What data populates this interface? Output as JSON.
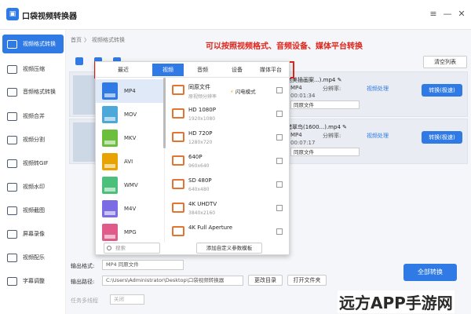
{
  "app": {
    "title": "口袋视频转换器",
    "window_controls": [
      "≡",
      "—",
      "✕"
    ]
  },
  "sidebar": {
    "items": [
      {
        "label": "视频格式转换",
        "active": true
      },
      {
        "label": "视频压缩"
      },
      {
        "label": "音频格式转换"
      },
      {
        "label": "视频合并"
      },
      {
        "label": "视频分割"
      },
      {
        "label": "视频转GIF"
      },
      {
        "label": "视频水印"
      },
      {
        "label": "视频截图"
      },
      {
        "label": "屏幕录像"
      },
      {
        "label": "视频配乐"
      },
      {
        "label": "字幕调整"
      }
    ]
  },
  "breadcrumb": [
    "首页",
    "〉",
    "视频格式转换"
  ],
  "annotation": "可以按照视频格式、音频设备、媒体平台转换",
  "toolbar": {
    "clear_label": "清空列表"
  },
  "tasks": [
    {
      "name": "绝美插画案...).mp4 ✎",
      "format": "MP4",
      "resolution_label": "分辨率:",
      "duration": "00:01:34",
      "quality": "同原文件",
      "process": "视频处理",
      "convert": "转换(极速)"
    },
    {
      "name": "猎翠鸟(1600...).mp4 ✎",
      "format": "MP4",
      "resolution_label": "分辨率:",
      "duration": "00:07:17",
      "quality": "同原文件",
      "process": "视频处理",
      "convert": "转换(极速)"
    }
  ],
  "popup": {
    "tabs": [
      "最近",
      "视频",
      "音频",
      "设备",
      "媒体平台"
    ],
    "active_tab": "视频",
    "formats": [
      {
        "label": "MP4",
        "color": "#2f7ae5"
      },
      {
        "label": "MOV",
        "color": "#4ba8d8"
      },
      {
        "label": "MKV",
        "color": "#6cbf3c"
      },
      {
        "label": "AVI",
        "color": "#e8a300"
      },
      {
        "label": "WMV",
        "color": "#4ac07a"
      },
      {
        "label": "M4V",
        "color": "#7b6ce5"
      },
      {
        "label": "MPG",
        "color": "#e05a8a"
      }
    ],
    "presets": [
      {
        "name": "同原文件",
        "sub": "原视频分辨率",
        "flash": "闪电模式"
      },
      {
        "name": "HD 1080P",
        "sub": "1920x1080"
      },
      {
        "name": "HD 720P",
        "sub": "1280x720"
      },
      {
        "name": "640P",
        "sub": "960x640"
      },
      {
        "name": "SD 480P",
        "sub": "640x480"
      },
      {
        "name": "4K UHDTV",
        "sub": "3840x2160"
      },
      {
        "name": "4K Full Aperture",
        "sub": ""
      }
    ],
    "search_placeholder": "搜索",
    "custom_label": "添加自定义参数模板"
  },
  "bottom": {
    "output_format_label": "输出格式:",
    "output_format_value": "MP4  同原文件",
    "output_path_label": "输出路径:",
    "output_path_value": "C:\\Users\\Administrator\\Desktop\\口袋视频转换器",
    "change_dir": "更改目录",
    "open_folder": "打开文件夹",
    "threads_label": "任务多线程",
    "threads_value": "关闭",
    "convert_all": "全部转换"
  },
  "watermark": "远方APP手游网"
}
